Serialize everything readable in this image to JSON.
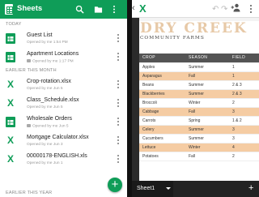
{
  "left": {
    "app_title": "Sheets",
    "sections": {
      "today": "TODAY",
      "earlier_this_month": "EARLIER THIS MONTH",
      "earlier_this_year": "EARLIER THIS YEAR"
    },
    "files": [
      {
        "name": "Guest List",
        "meta": "Opened by me 1:54 PM",
        "icon": "sheets-icon",
        "shared": false
      },
      {
        "name": "Apartment Locations",
        "meta": "Opened by me 1:17 PM",
        "icon": "sheets-icon",
        "shared": true
      },
      {
        "name": "Crop-rotation.xlsx",
        "meta": "Opened by me Jun 5",
        "icon": "excel-icon",
        "shared": false
      },
      {
        "name": "Class_Schedule.xlsx",
        "meta": "Opened by me Jun 5",
        "icon": "excel-icon",
        "shared": false
      },
      {
        "name": "Wholesale Orders",
        "meta": "Opened by me Jun 5",
        "icon": "sheets-icon",
        "shared": true
      },
      {
        "name": "Mortgage Calculator.xlsx",
        "meta": "Opened by me Jun 3",
        "icon": "excel-icon",
        "shared": false
      },
      {
        "name": "00000178-ENGLISH.xls",
        "meta": "Opened by me Jun 1",
        "icon": "excel-icon",
        "shared": false
      }
    ],
    "fab_label": "+",
    "colors": {
      "brand": "#0f9d58"
    }
  },
  "right": {
    "back_glyph": "‹",
    "logo_glyph": "X",
    "undo_glyph": "↶",
    "redo_glyph": "↷",
    "adduser_glyph": "+👤",
    "title": "DRY CREEK",
    "subtitle": "COMMUNITY FARMS",
    "headers": [
      "CROP",
      "SEASON",
      "FIELD"
    ],
    "rows": [
      [
        "Apples",
        "Summer",
        "1"
      ],
      [
        "Asparagus",
        "Fall",
        "1"
      ],
      [
        "Beans",
        "Summer",
        "2 & 3"
      ],
      [
        "Blackberries",
        "Summer",
        "2 & 3"
      ],
      [
        "Broccoli",
        "Winter",
        "2"
      ],
      [
        "Cabbage",
        "Fall",
        "3"
      ],
      [
        "Carrots",
        "Spring",
        "1 & 2"
      ],
      [
        "Celery",
        "Summer",
        "3"
      ],
      [
        "Cucumbers",
        "Summer",
        "3"
      ],
      [
        "Lettuce",
        "Winter",
        "4"
      ],
      [
        "Potatoes",
        "Fall",
        "2"
      ]
    ],
    "sheet_tab": "Sheet1",
    "add_sheet": "+",
    "colors": {
      "accent_row": "#f5cca3",
      "header_row": "#545454",
      "title": "#e7c9a7"
    }
  }
}
